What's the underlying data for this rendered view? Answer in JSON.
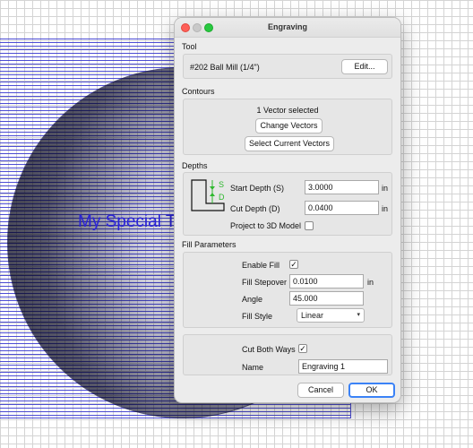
{
  "canvas": {
    "vector_text": "My Special T"
  },
  "dialog": {
    "title": "Engraving",
    "tool": {
      "section": "Tool",
      "name": "#202 Ball Mill (1/4\")",
      "edit_label": "Edit..."
    },
    "contours": {
      "section": "Contours",
      "status": "1 Vector selected",
      "change_label": "Change Vectors",
      "select_label": "Select Current Vectors"
    },
    "depths": {
      "section": "Depths",
      "diagram_s": "S",
      "diagram_d": "D",
      "start_label": "Start Depth (S)",
      "start_value": "3.0000",
      "start_unit": "in",
      "cut_label": "Cut Depth (D)",
      "cut_value": "0.0400",
      "cut_unit": "in",
      "project_label": "Project to 3D Model",
      "project_checked": false
    },
    "fill": {
      "section": "Fill Parameters",
      "enable_label": "Enable Fill",
      "enable_checked": true,
      "stepover_label": "Fill Stepover",
      "stepover_value": "0.0100",
      "stepover_unit": "in",
      "angle_label": "Angle",
      "angle_value": "45.000",
      "style_label": "Fill Style",
      "style_value": "Linear"
    },
    "misc": {
      "cut_both_label": "Cut Both Ways",
      "cut_both_checked": true,
      "name_label": "Name",
      "name_value": "Engraving 1"
    },
    "cancel_label": "Cancel",
    "ok_label": "OK",
    "check_glyph": "✓",
    "arrow_glyph": "▾"
  },
  "colors": {
    "hatch": "#3a3ad0",
    "vector_text": "#2a22d8",
    "ok_border": "#3b82f6",
    "depth_marker": "#2eb82e"
  }
}
